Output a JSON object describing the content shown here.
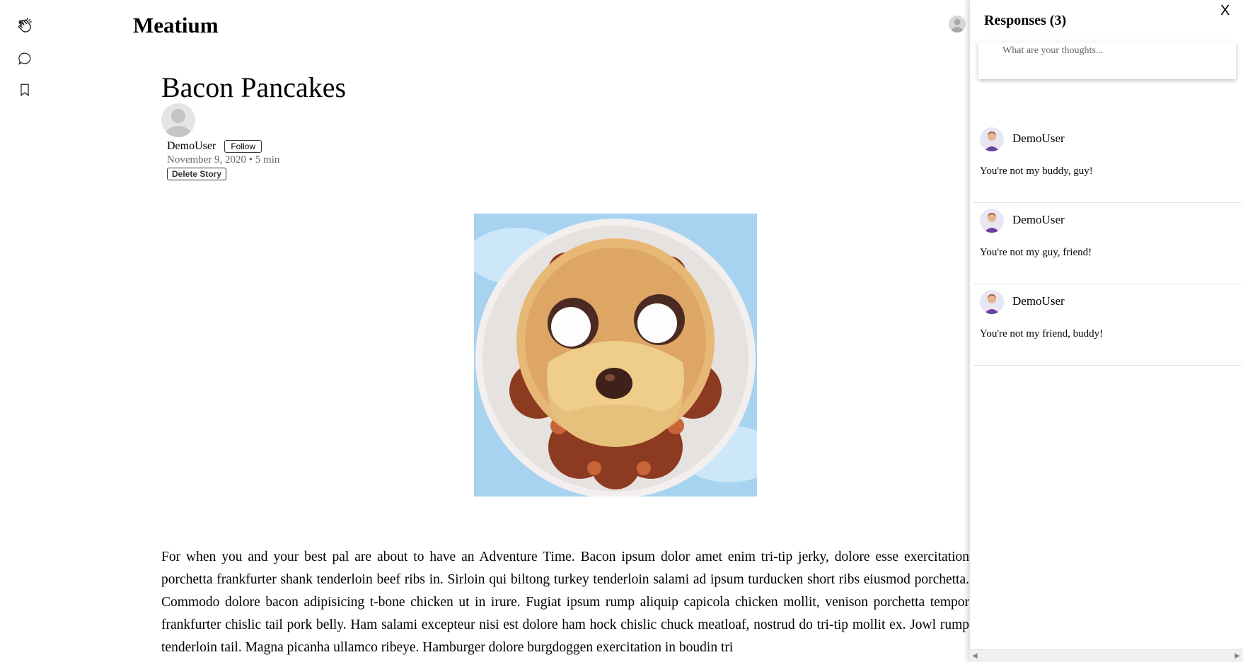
{
  "app": {
    "logo": "Meatium"
  },
  "rail": {
    "icons": [
      "clap-icon",
      "comment-icon",
      "bookmark-icon"
    ]
  },
  "article": {
    "title": "Bacon Pancakes",
    "author": "DemoUser",
    "follow_label": "Follow",
    "date_line": "November 9, 2020 • 5 min",
    "delete_label": "Delete Story",
    "image_alt": "Pancake shaped like a dog face on bacon",
    "body": "For when you and your best pal are about to have an Adventure Time. Bacon ipsum dolor amet enim tri-tip jerky, dolore esse exercitation porchetta frankfurter shank tenderloin beef ribs in. Sirloin qui biltong turkey tenderloin salami ad ipsum turducken short ribs eiusmod porchetta. Commodo dolore bacon adipisicing t-bone chicken ut in irure. Fugiat ipsum rump aliquip capicola chicken mollit, venison porchetta tempor frankfurter chislic tail pork belly. Ham salami excepteur nisi est dolore ham hock chislic chuck meatloaf, nostrud do tri-tip mollit ex. Jowl rump tenderloin tail. Magna picanha ullamco ribeye. Hamburger dolore burgdoggen exercitation in boudin tri"
  },
  "responses_panel": {
    "title": "Responses (3)",
    "close_label": "X",
    "compose_placeholder": "What are your thoughts...",
    "items": [
      {
        "user": "DemoUser",
        "text": "You're not my buddy, guy!"
      },
      {
        "user": "DemoUser",
        "text": "You're not my guy, friend!"
      },
      {
        "user": "DemoUser",
        "text": "You're not my friend, buddy!"
      }
    ]
  },
  "colors": {
    "avatar_purple": "#6a3fa0",
    "panel_border": "#e2e2e2"
  }
}
